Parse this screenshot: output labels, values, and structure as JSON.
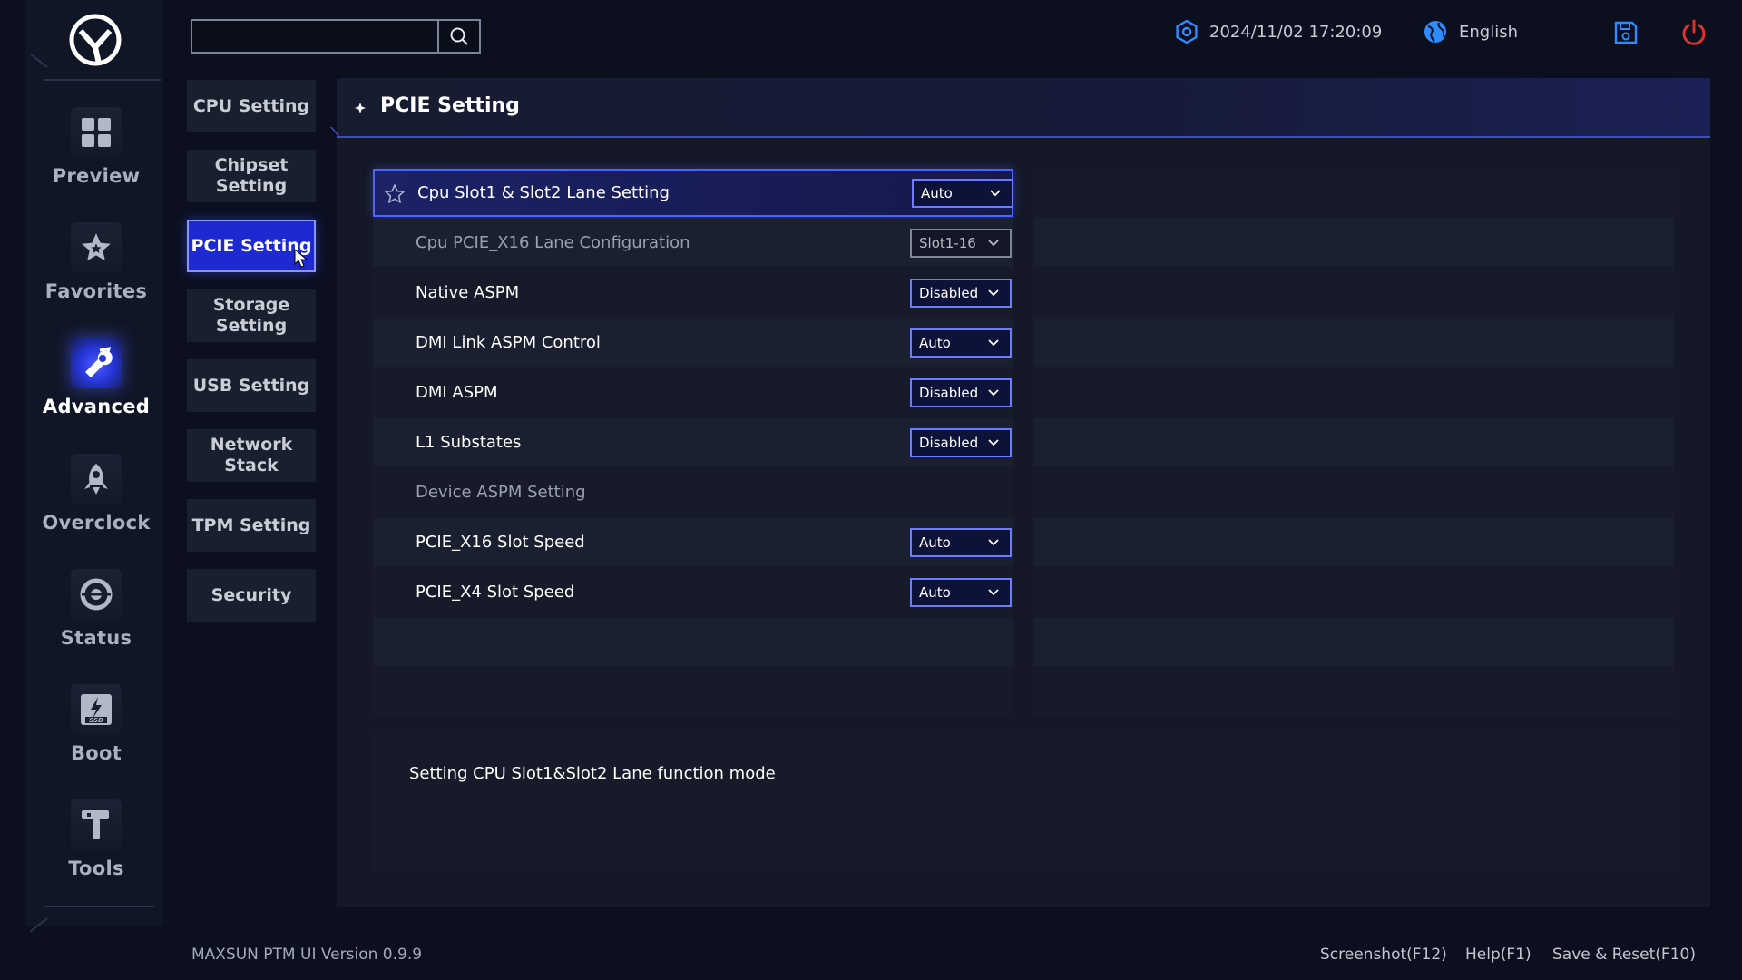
{
  "sidebar": {
    "items": [
      {
        "label": "Preview",
        "icon": "grid-icon"
      },
      {
        "label": "Favorites",
        "icon": "star-icon"
      },
      {
        "label": "Advanced",
        "icon": "wrench-icon",
        "active": true
      },
      {
        "label": "Overclock",
        "icon": "rocket-icon"
      },
      {
        "label": "Status",
        "icon": "gauge-icon"
      },
      {
        "label": "Boot",
        "icon": "ssd-icon"
      },
      {
        "label": "Tools",
        "icon": "hammer-icon"
      }
    ]
  },
  "search": {
    "placeholder": "",
    "value": ""
  },
  "topbar": {
    "datetime": "2024/11/02 17:20:09",
    "language": "English"
  },
  "submenu": {
    "items": [
      {
        "label": "CPU Setting"
      },
      {
        "label": "Chipset Setting"
      },
      {
        "label": "PCIE Setting",
        "active": true
      },
      {
        "label": "Storage Setting"
      },
      {
        "label": "USB Setting"
      },
      {
        "label": "Network Stack"
      },
      {
        "label": "TPM Setting"
      },
      {
        "label": "Security"
      }
    ]
  },
  "panel": {
    "title": "PCIE Setting",
    "settings": [
      {
        "label": "Cpu Slot1 & Slot2 Lane Setting",
        "value": "Auto",
        "selected": true
      },
      {
        "label": "Cpu PCIE_X16 Lane Configuration",
        "value": "Slot1-16",
        "disabled": true
      },
      {
        "label": "Native ASPM",
        "value": "Disabled"
      },
      {
        "label": "DMI Link ASPM Control",
        "value": "Auto"
      },
      {
        "label": "DMI ASPM",
        "value": "Disabled"
      },
      {
        "label": "L1 Substates",
        "value": "Disabled"
      },
      {
        "label": "Device ASPM Setting",
        "heading": true
      },
      {
        "label": "PCIE_X16 Slot Speed",
        "value": "Auto"
      },
      {
        "label": "PCIE_X4 Slot Speed",
        "value": "Auto"
      }
    ],
    "help_text": "Setting CPU Slot1&Slot2 Lane function mode"
  },
  "footer": {
    "version": "MAXSUN PTM UI Version 0.9.9",
    "screenshot": "Screenshot(F12)",
    "help": "Help(F1)",
    "save_reset": "Save & Reset(F10)"
  },
  "colors": {
    "accent": "#1d2ad1",
    "accent_border": "#6d7cff",
    "power": "#e0302a",
    "info_blue": "#2f8cff"
  }
}
